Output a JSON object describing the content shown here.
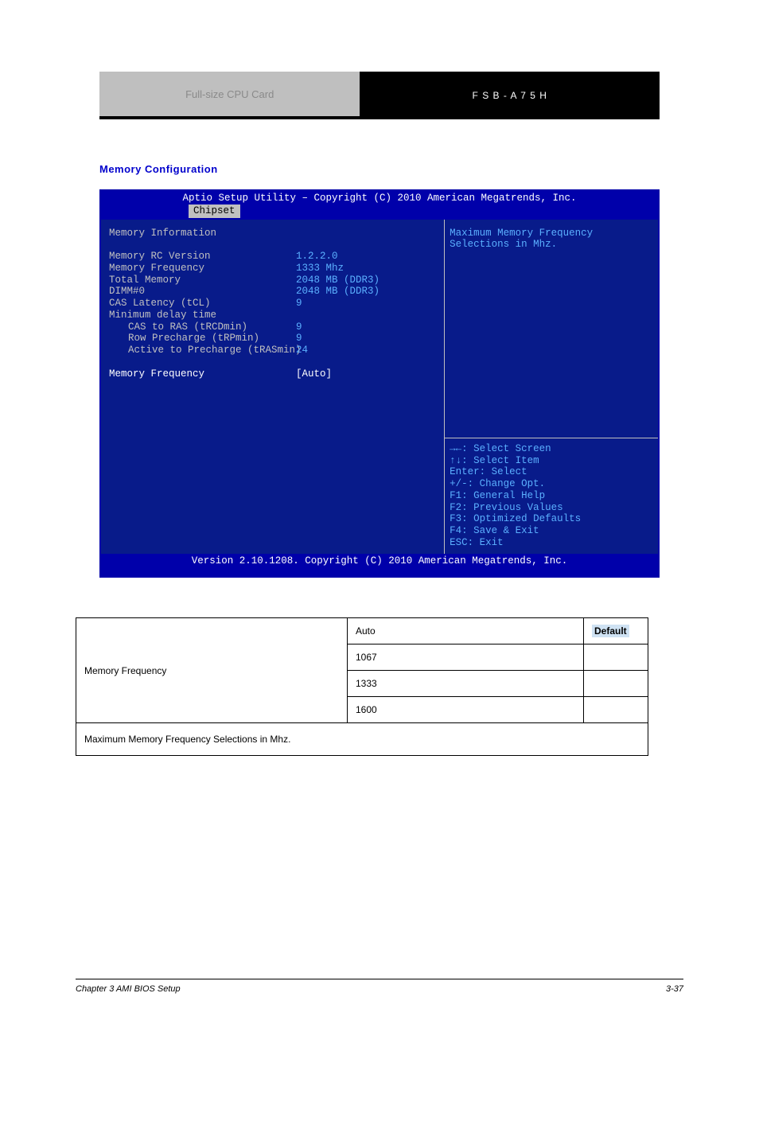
{
  "header": {
    "left": "Full-size CPU Card",
    "right": "F S B - A 7 5 H"
  },
  "section_title": "Memory Configuration",
  "bios": {
    "title_top": "Aptio Setup Utility – Copyright (C) 2010 American Megatrends, Inc.",
    "tab": "Chipset",
    "left": {
      "heading": "Memory Information",
      "rows": [
        {
          "label": "Memory RC Version",
          "value": "1.2.2.0"
        },
        {
          "label": "Memory Frequency",
          "value": "1333 Mhz"
        },
        {
          "label": "Total Memory",
          "value": "2048 MB (DDR3)"
        },
        {
          "label": "DIMM#0",
          "value": "2048 MB (DDR3)"
        },
        {
          "label": "CAS Latency (tCL)",
          "value": "9"
        },
        {
          "label": "Minimum delay time",
          "value": ""
        }
      ],
      "indented": [
        {
          "label": "CAS to RAS (tRCDmin)",
          "value": "9"
        },
        {
          "label": "Row Precharge (tRPmin)",
          "value": "9"
        },
        {
          "label": "Active to Precharge (tRASmin)",
          "value": "24"
        }
      ],
      "setting": {
        "label": "Memory Frequency",
        "value": "[Auto]"
      }
    },
    "right_help": [
      "Maximum Memory Frequency",
      "Selections in Mhz."
    ],
    "right_keys": [
      "→←: Select Screen",
      "↑↓: Select Item",
      "Enter: Select",
      "+/-: Change Opt.",
      "F1: General Help",
      "F2: Previous Values",
      "F3: Optimized Defaults",
      "F4: Save & Exit",
      "ESC: Exit"
    ],
    "footer": "Version 2.10.1208. Copyright (C) 2010 American Megatrends, Inc."
  },
  "table": {
    "setting": "Memory Frequency",
    "options": [
      {
        "label": "Auto",
        "default": "Default"
      },
      {
        "label": "1067",
        "default": ""
      },
      {
        "label": "1333",
        "default": ""
      },
      {
        "label": "1600",
        "default": ""
      }
    ],
    "description": "Maximum Memory Frequency Selections in Mhz."
  },
  "footer": {
    "left": "Chapter 3 AMI BIOS Setup",
    "right": "3-37"
  }
}
